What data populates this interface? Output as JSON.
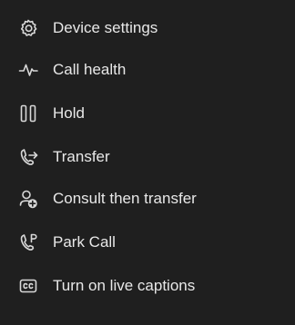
{
  "menu": {
    "items": [
      {
        "label": "Device settings",
        "icon": "gear-icon"
      },
      {
        "label": "Call health",
        "icon": "pulse-icon"
      },
      {
        "label": "Hold",
        "icon": "pause-icon"
      },
      {
        "label": "Transfer",
        "icon": "phone-transfer-icon"
      },
      {
        "label": "Consult then transfer",
        "icon": "person-add-icon"
      },
      {
        "label": "Park Call",
        "icon": "phone-park-icon"
      },
      {
        "label": "Turn on live captions",
        "icon": "closed-captions-icon"
      }
    ]
  }
}
